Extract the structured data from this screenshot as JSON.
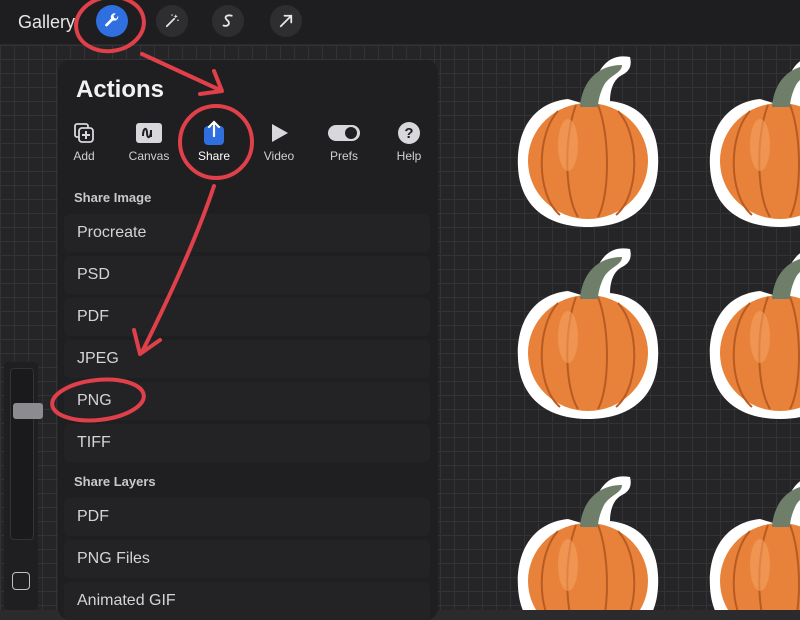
{
  "topbar": {
    "gallery_label": "Gallery",
    "tools": [
      "wrench-icon",
      "magic-wand-icon",
      "selection-s-icon",
      "transform-arrow-icon"
    ]
  },
  "actions": {
    "title": "Actions",
    "tabs": [
      {
        "label": "Add",
        "icon": "add-icon"
      },
      {
        "label": "Canvas",
        "icon": "canvas-icon"
      },
      {
        "label": "Share",
        "icon": "share-icon"
      },
      {
        "label": "Video",
        "icon": "play-icon"
      },
      {
        "label": "Prefs",
        "icon": "toggle-icon"
      },
      {
        "label": "Help",
        "icon": "help-icon"
      }
    ],
    "share_image": {
      "heading": "Share Image",
      "items": [
        "Procreate",
        "PSD",
        "PDF",
        "JPEG",
        "PNG",
        "TIFF"
      ]
    },
    "share_layers": {
      "heading": "Share Layers",
      "items": [
        "PDF",
        "PNG Files",
        "Animated GIF"
      ]
    }
  },
  "colors": {
    "accent": "#2f6fe0",
    "annotation": "#e0404a",
    "pumpkin": "#e8823a"
  }
}
